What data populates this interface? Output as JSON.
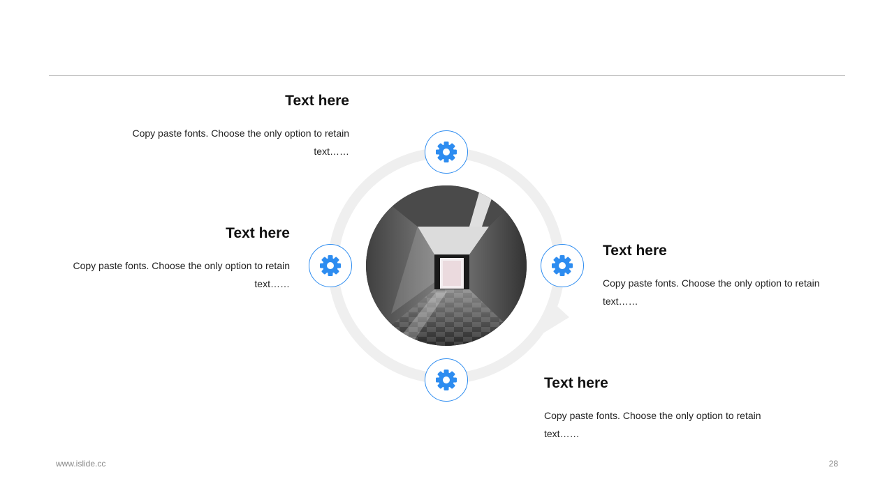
{
  "colors": {
    "accent": "#2d8cf0",
    "ring": "#efefef",
    "text": "#111111",
    "muted": "#888888"
  },
  "blocks": [
    {
      "title": "Text here",
      "body": "Copy paste fonts. Choose the only option to retain text……"
    },
    {
      "title": "Text here",
      "body": "Copy paste fonts. Choose the only option to retain text……"
    },
    {
      "title": "Text here",
      "body": "Copy paste fonts. Choose the only option to retain text……"
    },
    {
      "title": "Text here",
      "body": "Copy paste fonts. Choose the only option to retain text……"
    }
  ],
  "icons": [
    "gear-icon",
    "gear-icon",
    "gear-icon",
    "gear-icon"
  ],
  "footer": {
    "site": "www.islide.cc",
    "page": "28"
  }
}
